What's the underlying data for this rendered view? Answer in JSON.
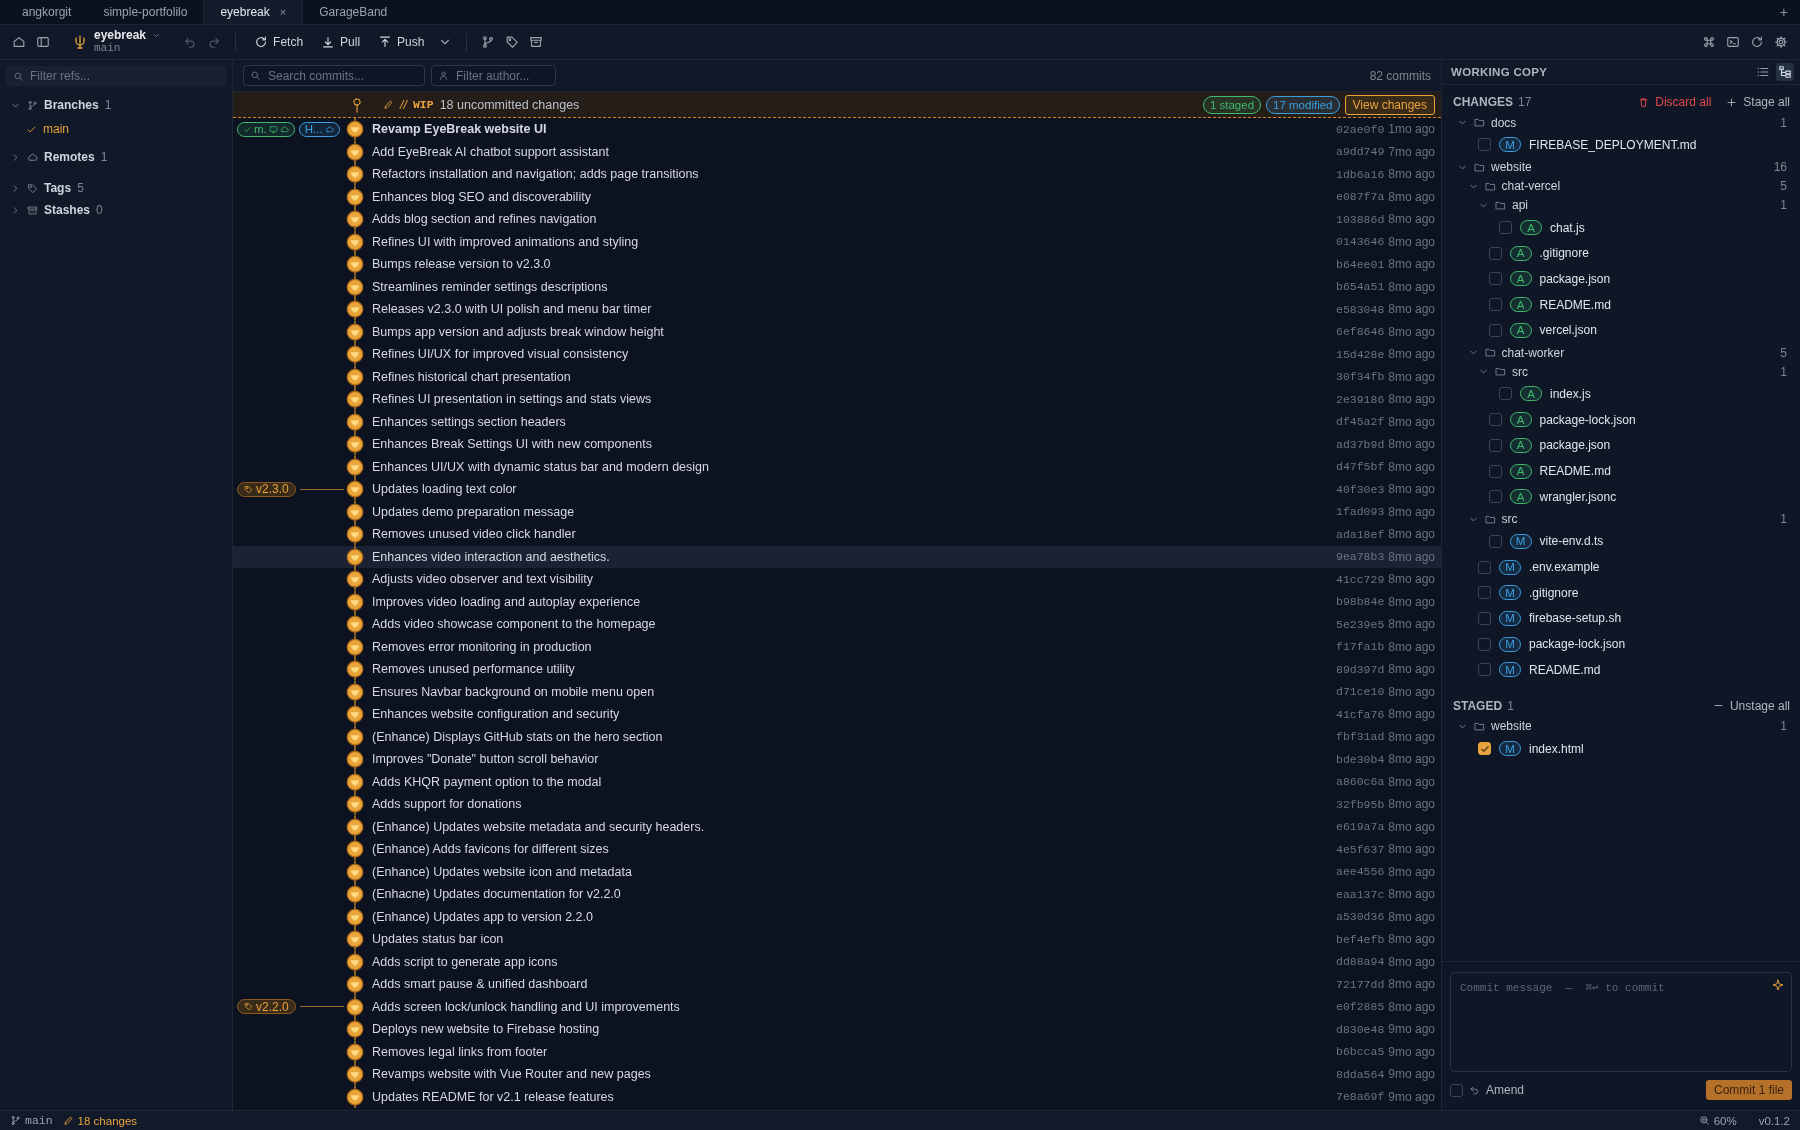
{
  "tabs": [
    {
      "label": "angkorgit",
      "selected": false
    },
    {
      "label": "simple-portfolilo",
      "selected": false
    },
    {
      "label": "eyebreak",
      "selected": true,
      "close": "×"
    },
    {
      "label": "GarageBand",
      "selected": false
    }
  ],
  "new_tab": "+",
  "toolbar": {
    "repo": "eyebreak",
    "branch": "main",
    "actions": [
      "Fetch",
      "Pull",
      "Push"
    ]
  },
  "sidebar": {
    "filter_placeholder": "Filter refs...",
    "sections": [
      {
        "label": "Branches",
        "count": "1",
        "expanded": true,
        "children": [
          {
            "label": "main",
            "current": true
          }
        ]
      },
      {
        "label": "Remotes",
        "count": "1",
        "expanded": false
      },
      {
        "label": "Tags",
        "count": "5",
        "expanded": false
      },
      {
        "label": "Stashes",
        "count": "0",
        "expanded": false
      }
    ]
  },
  "history": {
    "search_placeholder": "Search commits...",
    "author_placeholder": "Filter author...",
    "commit_count": "82 commits",
    "wip": {
      "prefix": "//",
      "label": "WIP",
      "text": "18 uncommitted changes",
      "badges": [
        {
          "text": "1 staged",
          "color": "#3fb96f"
        },
        {
          "text": "17 modified",
          "color": "#3b9ee0"
        }
      ],
      "button": "View changes"
    },
    "commits": [
      {
        "message": "Revamp EyeBreak website UI",
        "hash": "02ae0f0",
        "time": "1mo ago",
        "head": true,
        "selected": false,
        "refs": [
          {
            "kind": "branch",
            "label": "m.",
            "color": "#3fb96f"
          },
          {
            "kind": "branch",
            "label": "H...",
            "color": "#3b9ee0"
          }
        ]
      },
      {
        "message": "Add EyeBreak AI chatbot support assistant",
        "hash": "a9dd749",
        "time": "7mo ago",
        "head": false,
        "selected": false
      },
      {
        "message": "Refactors installation and navigation; adds page transitions",
        "hash": "1db6a16",
        "time": "8mo ago",
        "head": false,
        "selected": false
      },
      {
        "message": "Enhances blog SEO and discoverability",
        "hash": "e087f7a",
        "time": "8mo ago",
        "head": false,
        "selected": false
      },
      {
        "message": "Adds blog section and refines navigation",
        "hash": "103886d",
        "time": "8mo ago",
        "head": false,
        "selected": false
      },
      {
        "message": "Refines UI with improved animations and styling",
        "hash": "0143646",
        "time": "8mo ago",
        "head": false,
        "selected": false
      },
      {
        "message": "Bumps release version to v2.3.0",
        "hash": "b64ee01",
        "time": "8mo ago",
        "head": false,
        "selected": false
      },
      {
        "message": "Streamlines reminder settings descriptions",
        "hash": "b654a51",
        "time": "8mo ago",
        "head": false,
        "selected": false
      },
      {
        "message": "Releases v2.3.0 with UI polish and menu bar timer",
        "hash": "e583048",
        "time": "8mo ago",
        "head": false,
        "selected": false
      },
      {
        "message": "Bumps app version and adjusts break window height",
        "hash": "6ef8646",
        "time": "8mo ago",
        "head": false,
        "selected": false
      },
      {
        "message": "Refines UI/UX for improved visual consistency",
        "hash": "15d428e",
        "time": "8mo ago",
        "head": false,
        "selected": false
      },
      {
        "message": "Refines historical chart presentation",
        "hash": "30f34fb",
        "time": "8mo ago",
        "head": false,
        "selected": false
      },
      {
        "message": "Refines UI presentation in settings and stats views",
        "hash": "2e39186",
        "time": "8mo ago",
        "head": false,
        "selected": false
      },
      {
        "message": "Enhances settings section headers",
        "hash": "df45a2f",
        "time": "8mo ago",
        "head": false,
        "selected": false
      },
      {
        "message": "Enhances Break Settings UI with new components",
        "hash": "ad37b9d",
        "time": "8mo ago",
        "head": false,
        "selected": false
      },
      {
        "message": "Enhances UI/UX with dynamic status bar and modern design",
        "hash": "d47f5bf",
        "time": "8mo ago",
        "head": false,
        "selected": false
      },
      {
        "message": "Updates loading text color",
        "hash": "40f30e3",
        "time": "8mo ago",
        "head": false,
        "selected": false,
        "refs": [
          {
            "kind": "tag",
            "label": "v2.3.0"
          }
        ]
      },
      {
        "message": "Updates demo preparation message",
        "hash": "1fad093",
        "time": "8mo ago",
        "head": false,
        "selected": false
      },
      {
        "message": "Removes unused video click handler",
        "hash": "ada18ef",
        "time": "8mo ago",
        "head": false,
        "selected": false
      },
      {
        "message": "Enhances video interaction and aesthetics.",
        "hash": "9ea78b3",
        "time": "8mo ago",
        "head": false,
        "selected": true
      },
      {
        "message": "Adjusts video observer and text visibility",
        "hash": "41cc729",
        "time": "8mo ago",
        "head": false,
        "selected": false
      },
      {
        "message": "Improves video loading and autoplay experience",
        "hash": "b98b84e",
        "time": "8mo ago",
        "head": false,
        "selected": false
      },
      {
        "message": "Adds video showcase component to the homepage",
        "hash": "5e239e5",
        "time": "8mo ago",
        "head": false,
        "selected": false
      },
      {
        "message": "Removes error monitoring in production",
        "hash": "f17fa1b",
        "time": "8mo ago",
        "head": false,
        "selected": false
      },
      {
        "message": "Removes unused performance utility",
        "hash": "89d397d",
        "time": "8mo ago",
        "head": false,
        "selected": false
      },
      {
        "message": "Ensures Navbar background on mobile menu open",
        "hash": "d71ce10",
        "time": "8mo ago",
        "head": false,
        "selected": false
      },
      {
        "message": "Enhances website configuration and security",
        "hash": "41cfa76",
        "time": "8mo ago",
        "head": false,
        "selected": false
      },
      {
        "message": "(Enhance) Displays GitHub stats on the hero section",
        "hash": "fbf31ad",
        "time": "8mo ago",
        "head": false,
        "selected": false
      },
      {
        "message": "Improves \"Donate\" button scroll behavior",
        "hash": "bde30b4",
        "time": "8mo ago",
        "head": false,
        "selected": false
      },
      {
        "message": "Adds KHQR payment option to the modal",
        "hash": "a860c6a",
        "time": "8mo ago",
        "head": false,
        "selected": false
      },
      {
        "message": "Adds support for donations",
        "hash": "32fb95b",
        "time": "8mo ago",
        "head": false,
        "selected": false
      },
      {
        "message": "(Enhance) Updates website metadata and security headers.",
        "hash": "e619a7a",
        "time": "8mo ago",
        "head": false,
        "selected": false
      },
      {
        "message": "(Enhance) Adds favicons for different sizes",
        "hash": "4e5f637",
        "time": "8mo ago",
        "head": false,
        "selected": false
      },
      {
        "message": "(Enhance) Updates website icon and metadata",
        "hash": "aee4556",
        "time": "8mo ago",
        "head": false,
        "selected": false
      },
      {
        "message": "(Enhacne) Updates documentation for v2.2.0",
        "hash": "eaa137c",
        "time": "8mo ago",
        "head": false,
        "selected": false
      },
      {
        "message": "(Enhance) Updates app to version 2.2.0",
        "hash": "a530d36",
        "time": "8mo ago",
        "head": false,
        "selected": false
      },
      {
        "message": "Updates status bar icon",
        "hash": "bef4efb",
        "time": "8mo ago",
        "head": false,
        "selected": false
      },
      {
        "message": "Adds script to generate app icons",
        "hash": "dd88a94",
        "time": "8mo ago",
        "head": false,
        "selected": false
      },
      {
        "message": "Adds smart pause & unified dashboard",
        "hash": "72177dd",
        "time": "8mo ago",
        "head": false,
        "selected": false
      },
      {
        "message": "Adds screen lock/unlock handling and UI improvements",
        "hash": "e0f2885",
        "time": "8mo ago",
        "head": false,
        "selected": false,
        "refs": [
          {
            "kind": "tag",
            "label": "v2.2.0"
          }
        ]
      },
      {
        "message": "Deploys new website to Firebase hosting",
        "hash": "d830e48",
        "time": "9mo ago",
        "head": false,
        "selected": false
      },
      {
        "message": "Removes legal links from footer",
        "hash": "b6bcca5",
        "time": "9mo ago",
        "head": false,
        "selected": false
      },
      {
        "message": "Revamps website with Vue Router and new pages",
        "hash": "8dda564",
        "time": "9mo ago",
        "head": false,
        "selected": false
      },
      {
        "message": "Updates README for v2.1 release features",
        "hash": "7e8a69f",
        "time": "9mo ago",
        "head": false,
        "selected": false
      }
    ]
  },
  "working_copy": {
    "title": "WORKING COPY",
    "changes": {
      "label": "CHANGES",
      "count": "17",
      "discard": "Discard all",
      "stage": "Stage all",
      "tree": [
        {
          "kind": "folder",
          "name": "docs",
          "count": "1",
          "expanded": true,
          "children": [
            {
              "kind": "file",
              "name": "FIREBASE_DEPLOYMENT.md",
              "status": "M",
              "color": "#3b9ee0",
              "checked": false
            }
          ]
        },
        {
          "kind": "folder",
          "name": "website",
          "count": "16",
          "expanded": true,
          "children": [
            {
              "kind": "folder",
              "name": "chat-vercel",
              "count": "5",
              "expanded": true,
              "children": [
                {
                  "kind": "folder",
                  "name": "api",
                  "count": "1",
                  "expanded": true,
                  "children": [
                    {
                      "kind": "file",
                      "name": "chat.js",
                      "status": "A",
                      "color": "#3fb96f",
                      "checked": false
                    }
                  ]
                },
                {
                  "kind": "file",
                  "name": ".gitignore",
                  "status": "A",
                  "color": "#3fb96f",
                  "checked": false
                },
                {
                  "kind": "file",
                  "name": "package.json",
                  "status": "A",
                  "color": "#3fb96f",
                  "checked": false
                },
                {
                  "kind": "file",
                  "name": "README.md",
                  "status": "A",
                  "color": "#3fb96f",
                  "checked": false
                },
                {
                  "kind": "file",
                  "name": "vercel.json",
                  "status": "A",
                  "color": "#3fb96f",
                  "checked": false
                }
              ]
            },
            {
              "kind": "folder",
              "name": "chat-worker",
              "count": "5",
              "expanded": true,
              "children": [
                {
                  "kind": "folder",
                  "name": "src",
                  "count": "1",
                  "expanded": true,
                  "children": [
                    {
                      "kind": "file",
                      "name": "index.js",
                      "status": "A",
                      "color": "#3fb96f",
                      "checked": false
                    }
                  ]
                },
                {
                  "kind": "file",
                  "name": "package-lock.json",
                  "status": "A",
                  "color": "#3fb96f",
                  "checked": false
                },
                {
                  "kind": "file",
                  "name": "package.json",
                  "status": "A",
                  "color": "#3fb96f",
                  "checked": false
                },
                {
                  "kind": "file",
                  "name": "README.md",
                  "status": "A",
                  "color": "#3fb96f",
                  "checked": false
                },
                {
                  "kind": "file",
                  "name": "wrangler.jsonc",
                  "status": "A",
                  "color": "#3fb96f",
                  "checked": false
                }
              ]
            },
            {
              "kind": "folder",
              "name": "src",
              "count": "1",
              "expanded": true,
              "children": [
                {
                  "kind": "file",
                  "name": "vite-env.d.ts",
                  "status": "M",
                  "color": "#3b9ee0",
                  "checked": false
                }
              ]
            },
            {
              "kind": "file",
              "name": ".env.example",
              "status": "M",
              "color": "#3b9ee0",
              "checked": false
            },
            {
              "kind": "file",
              "name": ".gitignore",
              "status": "M",
              "color": "#3b9ee0",
              "checked": false
            },
            {
              "kind": "file",
              "name": "firebase-setup.sh",
              "status": "M",
              "color": "#3b9ee0",
              "checked": false
            },
            {
              "kind": "file",
              "name": "package-lock.json",
              "status": "M",
              "color": "#3b9ee0",
              "checked": false
            },
            {
              "kind": "file",
              "name": "README.md",
              "status": "M",
              "color": "#3b9ee0",
              "checked": false
            }
          ]
        }
      ]
    },
    "staged": {
      "label": "STAGED",
      "count": "1",
      "unstage": "Unstage all",
      "tree": [
        {
          "kind": "folder",
          "name": "website",
          "count": "1",
          "expanded": true,
          "children": [
            {
              "kind": "file",
              "name": "index.html",
              "status": "M",
              "color": "#3b9ee0",
              "checked": true
            }
          ]
        }
      ]
    },
    "commit": {
      "placeholder": "Commit message  —  ⌘↩ to commit",
      "amend": {
        "label": "Amend",
        "checked": false
      },
      "button": "Commit 1 file"
    }
  },
  "status_bar": {
    "branch": "main",
    "changes": "18 changes",
    "zoom": "60%",
    "version": "v0.1.2"
  }
}
